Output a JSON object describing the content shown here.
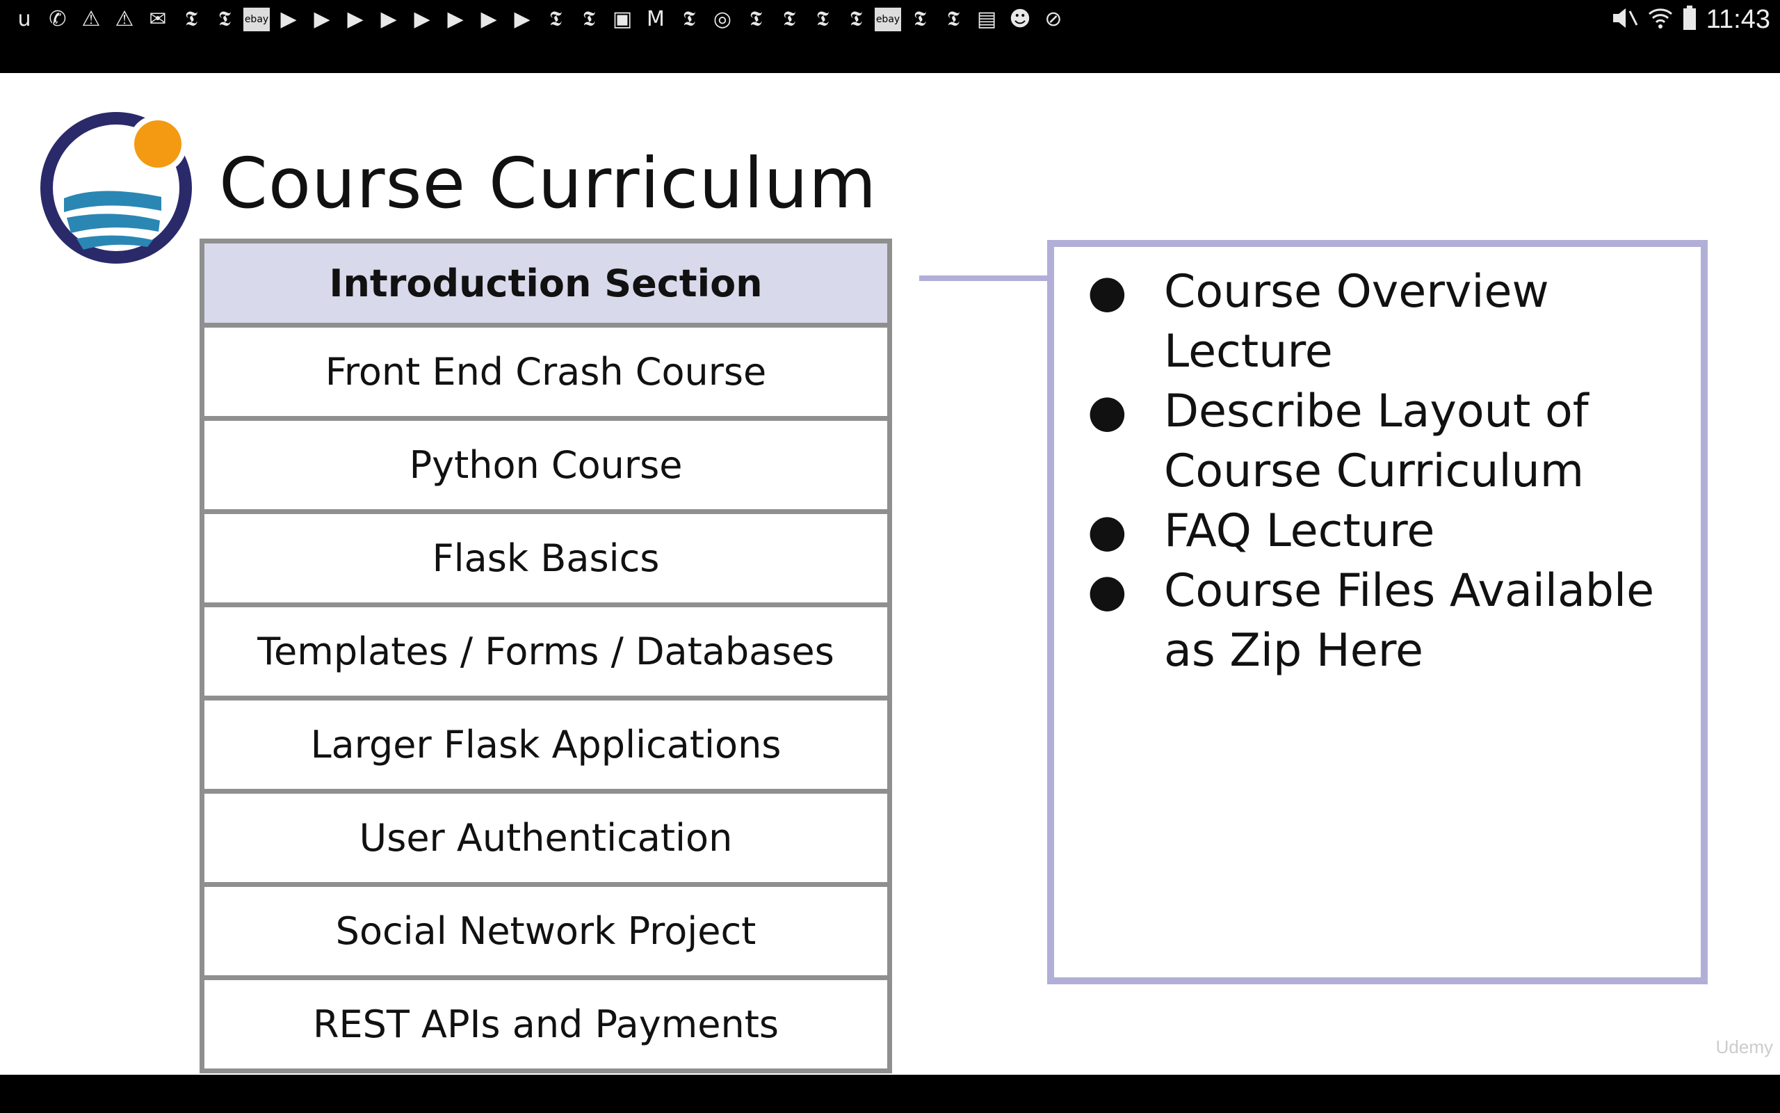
{
  "status_bar": {
    "notification_icons": [
      {
        "name": "app-u-icon",
        "glyph": "u"
      },
      {
        "name": "whatsapp-icon",
        "glyph": "✆"
      },
      {
        "name": "warning-icon",
        "glyph": "⚠"
      },
      {
        "name": "warning-icon",
        "glyph": "⚠"
      },
      {
        "name": "email-at-icon",
        "glyph": "✉"
      },
      {
        "name": "nytimes-icon",
        "glyph": "𝕿"
      },
      {
        "name": "nytimes-icon",
        "glyph": "𝕿"
      },
      {
        "name": "ebay-icon",
        "glyph": "ebay"
      },
      {
        "name": "youtube-icon",
        "glyph": "▶"
      },
      {
        "name": "youtube-icon",
        "glyph": "▶"
      },
      {
        "name": "youtube-icon",
        "glyph": "▶"
      },
      {
        "name": "youtube-icon",
        "glyph": "▶"
      },
      {
        "name": "youtube-icon",
        "glyph": "▶"
      },
      {
        "name": "youtube-icon",
        "glyph": "▶"
      },
      {
        "name": "youtube-icon",
        "glyph": "▶"
      },
      {
        "name": "youtube-icon",
        "glyph": "▶"
      },
      {
        "name": "nytimes-icon",
        "glyph": "𝕿"
      },
      {
        "name": "nytimes-icon",
        "glyph": "𝕿"
      },
      {
        "name": "image-icon",
        "glyph": "▣"
      },
      {
        "name": "gmail-icon",
        "glyph": "M"
      },
      {
        "name": "nytimes-icon",
        "glyph": "𝕿"
      },
      {
        "name": "instagram-icon",
        "glyph": "◎"
      },
      {
        "name": "nytimes-icon",
        "glyph": "𝕿"
      },
      {
        "name": "nytimes-icon",
        "glyph": "𝕿"
      },
      {
        "name": "nytimes-icon",
        "glyph": "𝕿"
      },
      {
        "name": "nytimes-icon",
        "glyph": "𝕿"
      },
      {
        "name": "ebay-icon",
        "glyph": "ebay"
      },
      {
        "name": "nytimes-icon",
        "glyph": "𝕿"
      },
      {
        "name": "nytimes-icon",
        "glyph": "𝕿"
      },
      {
        "name": "sim-card-icon",
        "glyph": "▤"
      },
      {
        "name": "cat-app-icon",
        "glyph": "☻"
      },
      {
        "name": "compass-icon",
        "glyph": "⊘"
      }
    ],
    "time": "11:43"
  },
  "slide": {
    "title": "Course Curriculum",
    "sections": [
      "Introduction Section",
      "Front End Crash Course",
      "Python Course",
      "Flask Basics",
      "Templates / Forms / Databases",
      "Larger Flask Applications",
      "User Authentication",
      "Social Network Project",
      "REST APIs and Payments"
    ],
    "highlighted_section_index": 0,
    "details": [
      "Course Overview Lecture",
      "Describe Layout of Course Curriculum",
      "FAQ Lecture",
      "Course Files Available as Zip Here"
    ],
    "bullet_glyph": "●",
    "watermark": "Udemy"
  },
  "colors": {
    "highlight_bg": "#d9d9ec",
    "accent_border": "#b1aed8",
    "row_border": "#8f8f8f",
    "logo_navy": "#2a2a6a",
    "logo_orange": "#f39a12",
    "logo_blue": "#2a87b4"
  }
}
